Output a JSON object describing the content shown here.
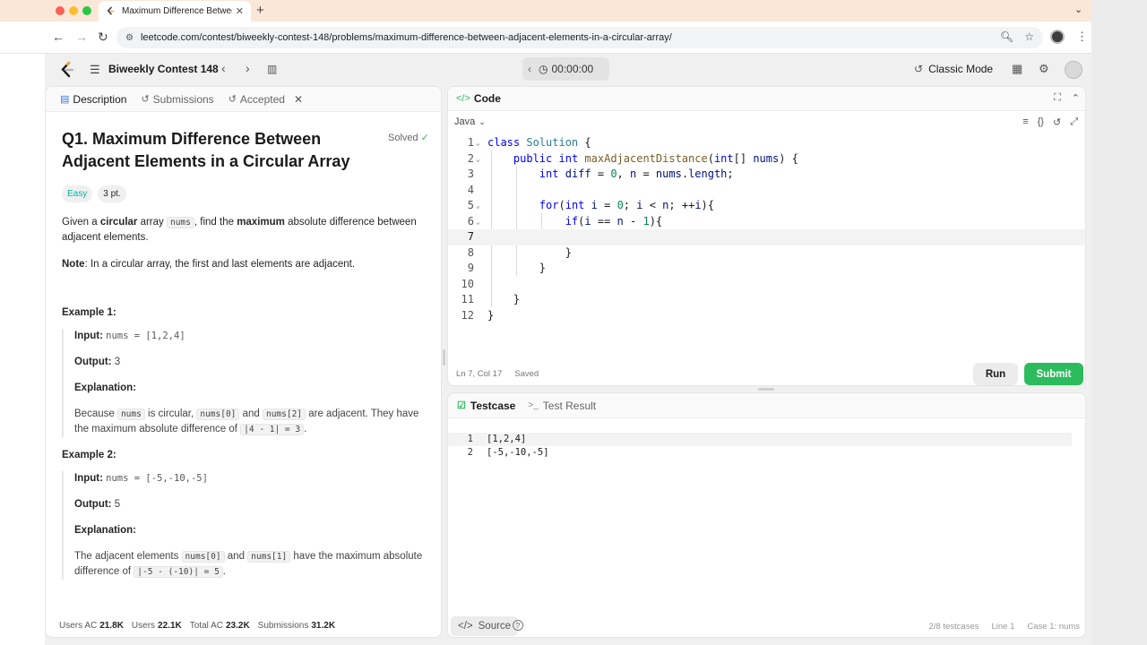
{
  "browser": {
    "tab_title": "Maximum Difference Betwee",
    "url": "leetcode.com/contest/biweekly-contest-148/problems/maximum-difference-between-adjacent-elements-in-a-circular-array/"
  },
  "header": {
    "contest_title": "Biweekly Contest 148",
    "timer": "00:00:00",
    "classic_mode": "Classic Mode"
  },
  "left_tabs": {
    "description": "Description",
    "submissions": "Submissions",
    "accepted": "Accepted"
  },
  "problem": {
    "title": "Q1. Maximum Difference Between Adjacent Elements in a Circular Array",
    "solved": "Solved",
    "difficulty": "Easy",
    "points": "3 pt.",
    "desc_pre": "Given a ",
    "desc_bold1": "circular",
    "desc_mid1": " array ",
    "desc_code": "nums",
    "desc_mid2": ", find the ",
    "desc_bold2": "maximum",
    "desc_post": " absolute difference between adjacent elements.",
    "note_label": "Note",
    "note_text": ": In a circular array, the first and last elements are adjacent.",
    "examples": [
      {
        "title": "Example 1:",
        "input_label": "Input:",
        "input": "nums = [1,2,4]",
        "output_label": "Output:",
        "output": "3",
        "explanation_label": "Explanation:",
        "exp_pre": "Because ",
        "exp_c1": "nums",
        "exp_mid1": " is circular, ",
        "exp_c2": "nums[0]",
        "exp_mid2": " and ",
        "exp_c3": "nums[2]",
        "exp_mid3": " are adjacent. They have the maximum absolute difference of ",
        "exp_c4": "|4 - 1| = 3",
        "exp_post": "."
      },
      {
        "title": "Example 2:",
        "input_label": "Input:",
        "input": "nums = [-5,-10,-5]",
        "output_label": "Output:",
        "output": "5",
        "explanation_label": "Explanation:",
        "exp_pre": "The adjacent elements ",
        "exp_c2": "nums[0]",
        "exp_mid2": " and ",
        "exp_c3": "nums[1]",
        "exp_mid3": " have the maximum absolute difference of ",
        "exp_c4": "|-5 - (-10)| = 5",
        "exp_post": "."
      }
    ]
  },
  "stats": {
    "users_ac_label": "Users AC",
    "users_ac": "21.8K",
    "users_label": "Users",
    "users": "22.1K",
    "total_ac_label": "Total AC",
    "total_ac": "23.2K",
    "submissions_label": "Submissions",
    "submissions": "31.2K"
  },
  "code_panel": {
    "title": "Code",
    "language": "Java",
    "cursor": "Ln 7, Col 17",
    "saved": "Saved",
    "run": "Run",
    "submit": "Submit"
  },
  "testcase_panel": {
    "testcase_tab": "Testcase",
    "result_tab": "Test Result",
    "lines": [
      "[1,2,4]",
      "[-5,-10,-5]"
    ],
    "source": "Source",
    "status_count": "2/8 testcases",
    "status_line": "Line 1",
    "status_case": "Case 1: nums"
  },
  "icons": {
    "logo": "leetcode-logo-icon",
    "timer": "clock-icon",
    "accent": "#2cbb5d",
    "easy": "#00b8a3"
  }
}
